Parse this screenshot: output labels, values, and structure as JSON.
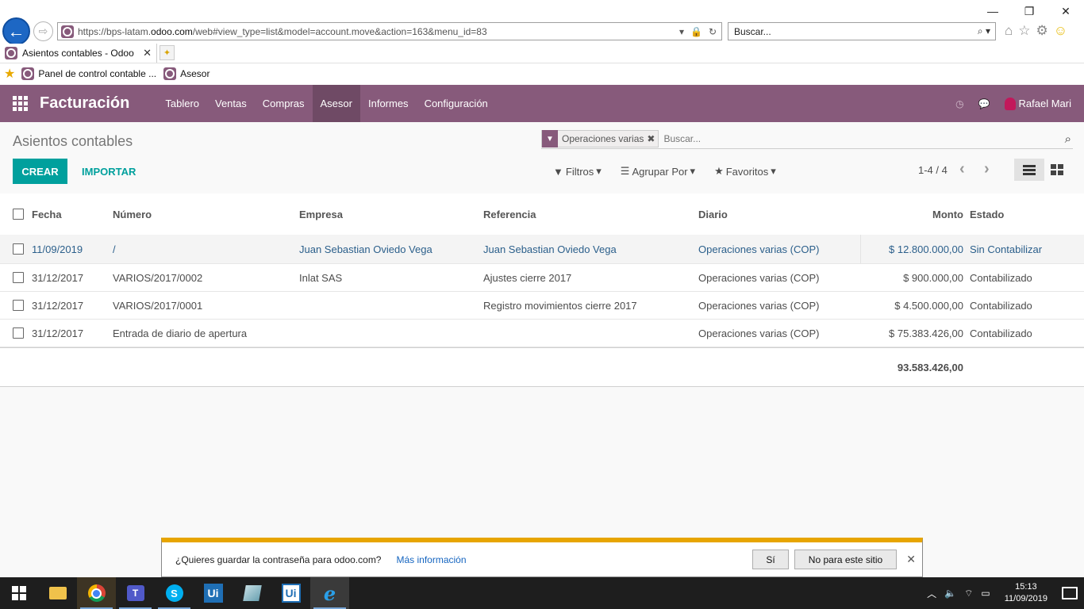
{
  "window": {
    "minimize": "—",
    "restore": "❐",
    "close": "✕"
  },
  "browser": {
    "url_prefix": "https://bps-latam.",
    "url_domain": "odoo.com",
    "url_suffix": "/web#view_type=list&model=account.move&action=163&menu_id=83",
    "search_placeholder": "Buscar...",
    "tab_title": "Asientos contables - Odoo",
    "favorites": [
      "Panel de control contable ...",
      "Asesor"
    ]
  },
  "navbar": {
    "brand": "Facturación",
    "menu": [
      "Tablero",
      "Ventas",
      "Compras",
      "Asesor",
      "Informes",
      "Configuración"
    ],
    "active_menu": "Asesor",
    "user": "Rafael Mari"
  },
  "control_panel": {
    "title": "Asientos contables",
    "facet": "Operaciones varias",
    "search_placeholder": "Buscar...",
    "create_label": "CREAR",
    "import_label": "IMPORTAR",
    "filters_label": "Filtros",
    "groupby_label": "Agrupar Por",
    "favorites_label": "Favoritos",
    "pager": "1-4 / 4"
  },
  "list": {
    "columns": [
      "Fecha",
      "Número",
      "Empresa",
      "Referencia",
      "Diario",
      "Monto",
      "Estado"
    ],
    "rows": [
      {
        "fecha": "11/09/2019",
        "numero": "/",
        "empresa": "Juan Sebastian Oviedo Vega",
        "referencia": "Juan Sebastian Oviedo Vega",
        "diario": "Operaciones varias (COP)",
        "monto": "$ 12.800.000,00",
        "estado": "Sin Contabilizar"
      },
      {
        "fecha": "31/12/2017",
        "numero": "VARIOS/2017/0002",
        "empresa": "Inlat SAS",
        "referencia": "Ajustes cierre 2017",
        "diario": "Operaciones varias (COP)",
        "monto": "$ 900.000,00",
        "estado": "Contabilizado"
      },
      {
        "fecha": "31/12/2017",
        "numero": "VARIOS/2017/0001",
        "empresa": "",
        "referencia": "Registro movimientos cierre 2017",
        "diario": "Operaciones varias (COP)",
        "monto": "$ 4.500.000,00",
        "estado": "Contabilizado"
      },
      {
        "fecha": "31/12/2017",
        "numero": "Entrada de diario de apertura",
        "empresa": "",
        "referencia": "",
        "diario": "Operaciones varias (COP)",
        "monto": "$ 75.383.426,00",
        "estado": "Contabilizado"
      }
    ],
    "total": "93.583.426,00"
  },
  "password_bar": {
    "message": "¿Quieres guardar la contraseña para odoo.com?",
    "more_info": "Más información",
    "yes": "Sí",
    "no": "No para este sitio"
  },
  "taskbar": {
    "time": "15:13",
    "date": "11/09/2019"
  }
}
